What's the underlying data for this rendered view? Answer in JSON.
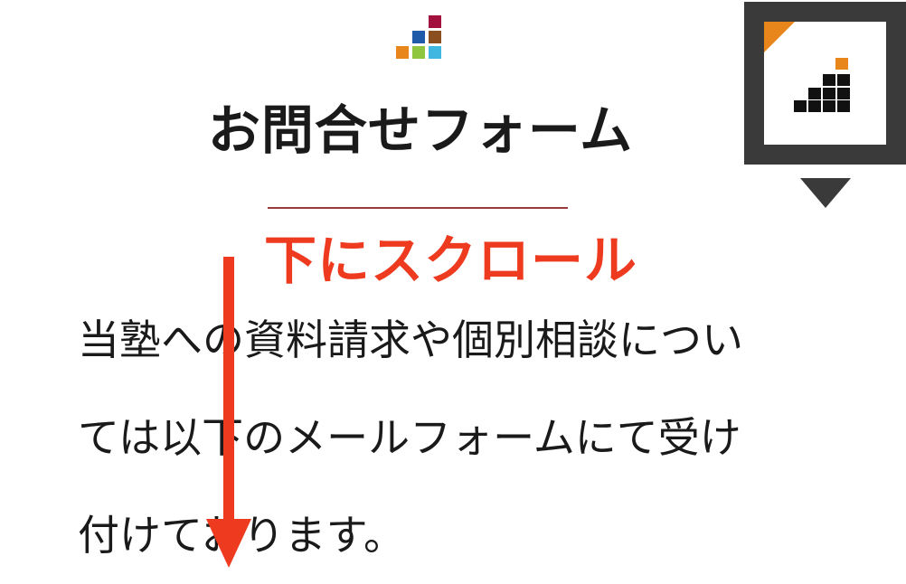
{
  "header": {
    "title": "お問合せフォーム"
  },
  "scroll_hint": {
    "label": "下にスクロール"
  },
  "intro": {
    "lines": [
      "当塾への資料請求や個別相談につい",
      "ては以下のメールフォームにて受け",
      "付けております。"
    ]
  },
  "colors": {
    "text": "#1a1a1a",
    "accent_red": "#ee3a1f",
    "divider": "#9b3b3b",
    "widget_frame": "#3a3a3a",
    "widget_accent": "#e8861c",
    "icon_dark": "#111111",
    "mosaic_crimson": "#a3123f",
    "mosaic_blue": "#1f5ba8",
    "mosaic_brown": "#8b4e1f",
    "mosaic_orange": "#e8861c",
    "mosaic_green": "#8ec63f",
    "mosaic_cyan": "#3fb7e0"
  },
  "icons": {
    "logo": "mosaic-logo-icon",
    "menu_widget": "stairs-icon",
    "pointer": "triangle-down-icon",
    "scroll_arrow": "arrow-down-icon"
  }
}
